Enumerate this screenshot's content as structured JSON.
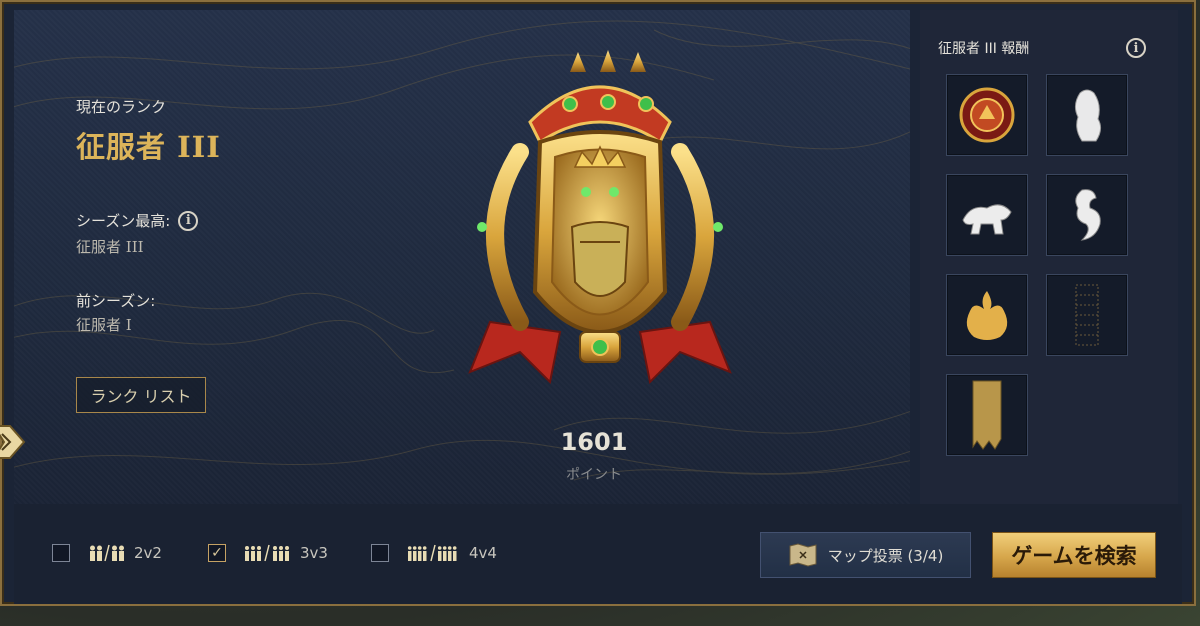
{
  "current_rank": {
    "label": "現在のランク",
    "title": "征服者 III"
  },
  "season_high": {
    "label": "シーズン最高:",
    "value": "征服者 III"
  },
  "previous_season": {
    "label": "前シーズン:",
    "value": "征服者 I"
  },
  "rank_list_button": "ランク リスト",
  "points": {
    "value": "1601",
    "label": "ポイント"
  },
  "rewards": {
    "title": "征服者 III 報酬",
    "items": [
      {
        "icon": "emblem-medallion-icon"
      },
      {
        "icon": "ghost-figure-icon"
      },
      {
        "icon": "tiger-icon"
      },
      {
        "icon": "dragon-icon"
      },
      {
        "icon": "flame-icon"
      },
      {
        "icon": "pattern-icon"
      },
      {
        "icon": "banner-icon"
      }
    ]
  },
  "queue": {
    "options": [
      {
        "label": "2v2",
        "checked": false
      },
      {
        "label": "3v3",
        "checked": true
      },
      {
        "label": "4v4",
        "checked": false
      }
    ]
  },
  "map_vote_button": "マップ投票 (3/4)",
  "search_button": "ゲームを検索",
  "colors": {
    "accent_gold": "#dcb45a",
    "panel": "#1f2a3e",
    "button_gold": "#d6a64b"
  }
}
